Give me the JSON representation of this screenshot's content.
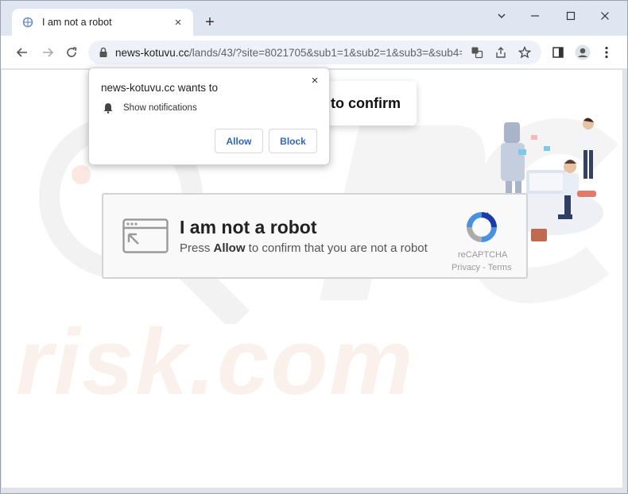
{
  "tab": {
    "title": "I am not a robot",
    "close": "×"
  },
  "new_tab": "+",
  "url": {
    "host": "news-kotuvu.cc",
    "path": "/lands/43/?site=8021705&sub1=1&sub2=1&sub3=&sub4="
  },
  "page": {
    "confirm_fragment": "to confirm"
  },
  "captcha": {
    "title": "I am not a robot",
    "sub_prefix": "Press ",
    "sub_bold": "Allow",
    "sub_suffix": " to confirm that you are not a robot",
    "brand": "reCAPTCHA",
    "links": "Privacy - Terms"
  },
  "permission_popup": {
    "title": "news-kotuvu.cc wants to",
    "permission": "Show notifications",
    "allow": "Allow",
    "block": "Block",
    "close": "×"
  },
  "watermark": "risk.com",
  "colors": {
    "accent": "#3166b8",
    "omnibox_bg": "#eef2f8",
    "titlebar_bg": "#dfe6f1"
  },
  "icons": [
    "favicon-icon",
    "close-icon",
    "back-icon",
    "forward-icon",
    "reload-icon",
    "lock-icon",
    "translate-icon",
    "share-icon",
    "star-icon",
    "sidepanel-icon",
    "profile-icon",
    "menu-icon",
    "bell-icon",
    "recaptcha-icon",
    "browser-window-icon"
  ]
}
